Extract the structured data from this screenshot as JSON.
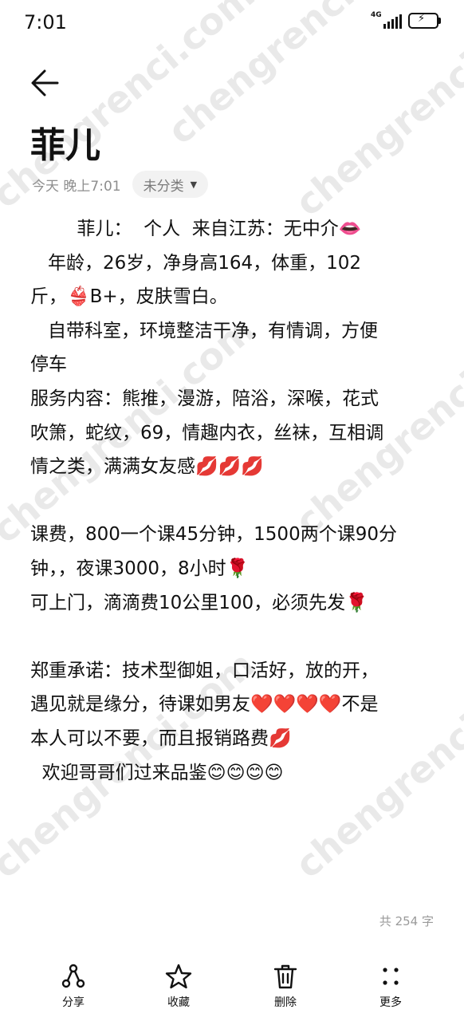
{
  "status_bar": {
    "time": "7:01",
    "network": "4G"
  },
  "note": {
    "title": "菲儿",
    "date": "今天 晚上7:01",
    "category": "未分类",
    "lines": [
      "        菲儿：  个人  来自江苏：无中介👄",
      "   年龄，26岁，净身高164，体重，102",
      "斤，👙B+，皮肤雪白。",
      "   自带科室，环境整洁干净，有情调，方便",
      "停车",
      "服务内容：熊推，漫游，陪浴，深喉，花式",
      "吹箫，蛇纹，69，情趣内衣，丝袜，互相调",
      "情之类，满满女友感💋💋💋",
      "",
      "课费，800一个课45分钟，1500两个课90分",
      "钟，，夜课3000，8小时🌹",
      "可上门，滴滴费10公里100，必须先发🌹",
      "",
      "郑重承诺：技术型御姐，口活好，放的开，",
      "遇见就是缘分，待课如男友❤️❤️❤️❤️不是",
      "本人可以不要，而且报销路费💋",
      "  欢迎哥哥们过来品鉴😊😊😊😊"
    ],
    "word_count": "共 254 字"
  },
  "toolbar": {
    "share": "分享",
    "favorite": "收藏",
    "delete": "删除",
    "more": "更多"
  },
  "watermark": "chengrenci.com"
}
